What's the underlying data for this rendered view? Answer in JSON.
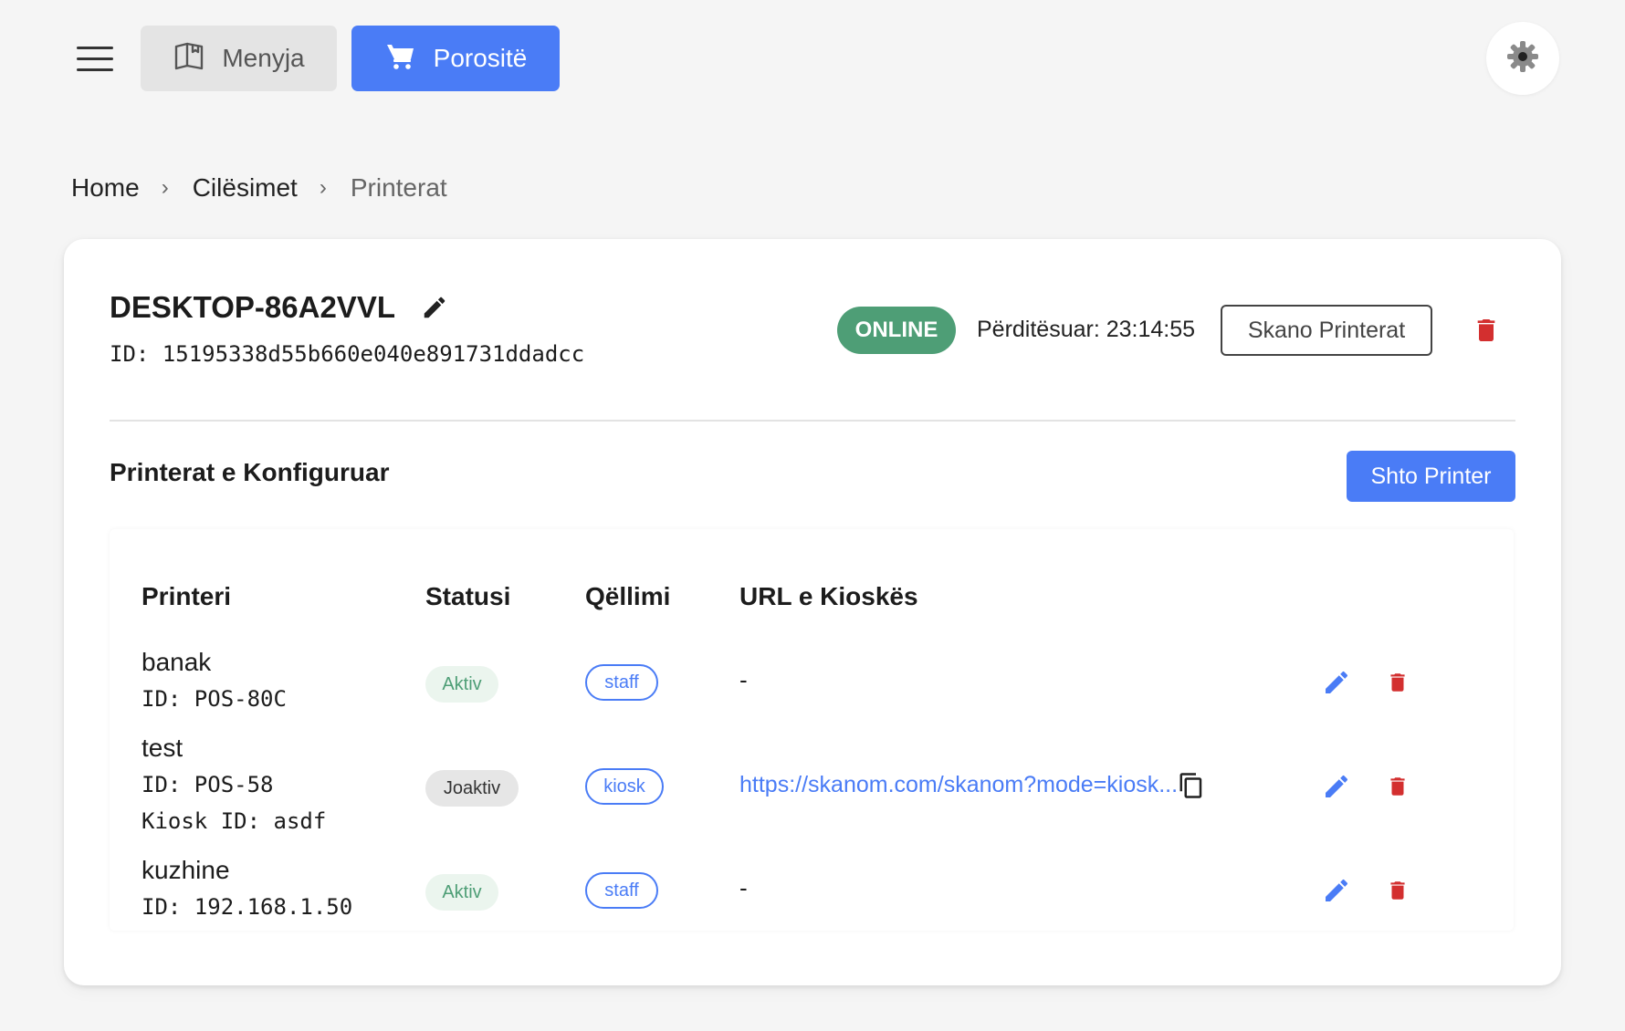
{
  "nav": {
    "menu_label": "Menyja",
    "orders_label": "Porositë"
  },
  "breadcrumb": {
    "items": [
      "Home",
      "Cilësimet",
      "Printerat"
    ]
  },
  "device": {
    "name": "DESKTOP-86A2VVL",
    "id_line": "ID: 15195338d55b660e040e891731ddadcc",
    "status": "ONLINE",
    "updated": "Përditësuar: 23:14:55",
    "scan_label": "Skano Printerat"
  },
  "section": {
    "title": "Printerat e Konfiguruar",
    "add_label": "Shto Printer"
  },
  "table": {
    "headers": [
      "Printeri",
      "Statusi",
      "Qëllimi",
      "URL e Kioskës"
    ],
    "rows": [
      {
        "name": "banak",
        "lines": [
          "ID: POS-80C"
        ],
        "status": "Aktiv",
        "purpose": "staff",
        "url": "-"
      },
      {
        "name": "test",
        "lines": [
          "ID: POS-58",
          "Kiosk ID: asdf"
        ],
        "status": "Joaktiv",
        "purpose": "kiosk",
        "url": "https://skanom.com/skanom?mode=kiosk..."
      },
      {
        "name": "kuzhine",
        "lines": [
          "ID: 192.168.1.50"
        ],
        "status": "Aktiv",
        "purpose": "staff",
        "url": "-"
      }
    ]
  },
  "colors": {
    "primary": "#4a7cf6",
    "online": "#4e9e76",
    "danger": "#d32f2f",
    "active_bg": "#ebf5ee",
    "inactive_bg": "#e6e6e6"
  },
  "icons": {
    "hamburger": "hamburger-icon",
    "menu": "book-icon",
    "orders": "cart-icon",
    "settings": "gear-icon",
    "edit": "pencil-icon",
    "delete": "trash-icon",
    "copy": "copy-icon"
  }
}
